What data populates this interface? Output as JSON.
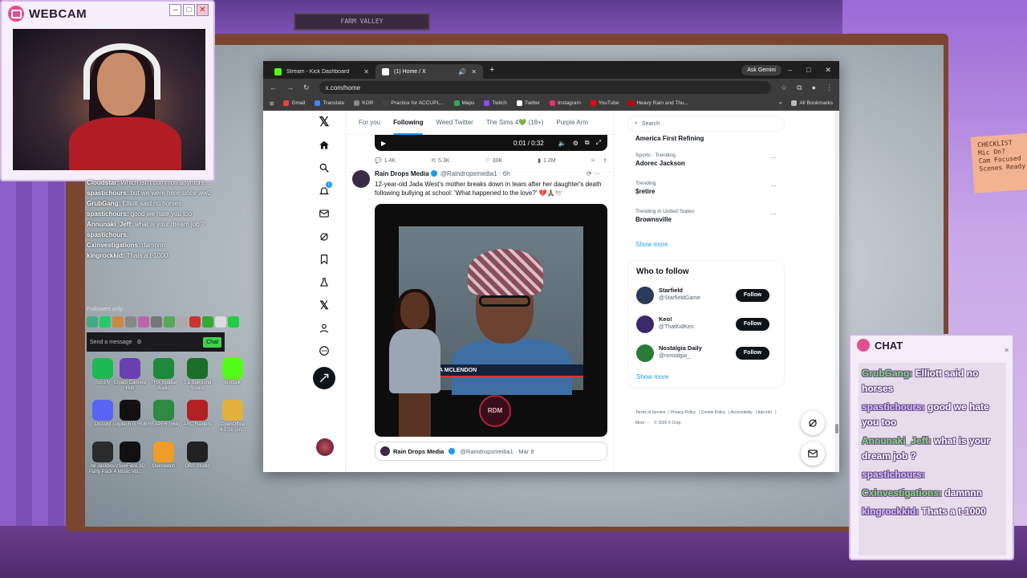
{
  "webcam": {
    "title": "WEBCAM",
    "controls": [
      "–",
      "□",
      "✕"
    ]
  },
  "scene": {
    "shelf_sign": "FARM VALLEY",
    "sticky_note": [
      "CHECKLIST",
      "Mic On?",
      "Cam Focused",
      "Scenes Ready"
    ]
  },
  "stream_chat": {
    "lines": [
      {
        "user": "Cloudstar:",
        "text": "Which isn't common anymore."
      },
      {
        "user": "spastichours:",
        "text": "but we were here since ww2"
      },
      {
        "user": "GrubGang:",
        "text": "Elliott said no horses"
      },
      {
        "user": "spastichours:",
        "text": "good we hate you too"
      },
      {
        "user": "Annunaki_Jeff:",
        "text": "what is your dream job ?"
      },
      {
        "user": "spastichours:",
        "text": ""
      },
      {
        "user": "Cxinvestigations:",
        "text": "damnnn"
      },
      {
        "user": "kingrockkid:",
        "text": "Thats a t-1000"
      }
    ],
    "followers_only": "Followers only",
    "send_placeholder": "Send a message",
    "chat_button": "Chat"
  },
  "desktop_icons": [
    {
      "label": "Spotify",
      "color": "#1db954"
    },
    {
      "label": "Elgato Camera Hub",
      "color": "#6a3fb0"
    },
    {
      "label": "THX Spatial Audio",
      "color": "#1c8a3a"
    },
    {
      "label": "7.1 Surround Sound",
      "color": "#1a6e2a"
    },
    {
      "label": "kicktalk",
      "color": "#53fc18"
    },
    {
      "label": "Discord",
      "color": "#5865f2"
    },
    {
      "label": "Logitech G HUB",
      "color": "#111111"
    },
    {
      "label": "REAPER (x64)",
      "color": "#2e8a3e"
    },
    {
      "label": "ARC Raiders",
      "color": "#b22222"
    },
    {
      "label": "OpenOffice 4.1.16 (en...",
      "color": "#e2b13c"
    },
    {
      "label": "he Jackbox Party Pack 4",
      "color": "#2b2b2b"
    },
    {
      "label": "VSeeFace 3D Music Vis...",
      "color": "#111111"
    },
    {
      "label": "Overwatch",
      "color": "#f09c28"
    },
    {
      "label": "OBS Studio",
      "color": "#222222"
    }
  ],
  "browser": {
    "tabs": [
      {
        "label": "Stream - Kick Dashboard",
        "color": "#53fc18"
      },
      {
        "label": "(1) Home / X",
        "color": "#ffffff"
      }
    ],
    "new_tab": "+",
    "ask_gemini": "Ask Gemini",
    "url": "x.com/home",
    "bookmarks": [
      {
        "label": "Gmail",
        "color": "#ea4335"
      },
      {
        "label": "Translate",
        "color": "#4285f4"
      },
      {
        "label": "KOR",
        "color": "#888888"
      },
      {
        "label": "Practice for ACCUPL...",
        "color": "#444444"
      },
      {
        "label": "Maps",
        "color": "#34a853"
      },
      {
        "label": "Twitch",
        "color": "#9146ff"
      },
      {
        "label": "Twitter",
        "color": "#ffffff"
      },
      {
        "label": "Instagram",
        "color": "#e1306c"
      },
      {
        "label": "YouTube",
        "color": "#ff0000"
      },
      {
        "label": "Heavy Rain and Thu...",
        "color": "#cc0000"
      }
    ],
    "all_bookmarks": "All Bookmarks"
  },
  "x": {
    "notification_count": "1",
    "feed_tabs": [
      "For you",
      "Following",
      "Weed Twitter",
      "The Sims 4💚 (18+)",
      "Purple Arm"
    ],
    "active_tab": "Following",
    "video_time": "0:01 / 0:32",
    "actions": {
      "replies": "1.4K",
      "reposts": "5.3K",
      "likes": "30K",
      "views": "1.2M"
    },
    "post": {
      "name": "Rain Drops Media",
      "handle": "@Raindropsmedia1 · 6h",
      "text": "12-year-old Jada West's mother breaks down in tears after her daughter's death following bullying at school: 'What happened to the love?' 💔🙏🏽🕊️",
      "lower_third": "A MCLENDON",
      "logo": "RDM"
    },
    "quote": {
      "name": "Rain Drops Media",
      "handle": "@Raindropsmedia1 · Mar 9"
    },
    "search_placeholder": "Search",
    "trends": [
      {
        "category": "",
        "name": "America First Refining"
      },
      {
        "category": "Sports · Trending",
        "name": "Adorec Jackson"
      },
      {
        "category": "Trending",
        "name": "$retire"
      },
      {
        "category": "Trending in United States",
        "name": "Brownsville"
      }
    ],
    "show_more": "Show more",
    "who_to_follow": "Who to follow",
    "follow_suggestions": [
      {
        "name": "Starfield",
        "handle": "@StarfieldGame",
        "color": "#2a3b5c"
      },
      {
        "name": "Keo!",
        "handle": "@ThatKidKeo",
        "color": "#3a2a6a"
      },
      {
        "name": "Nostalgia Daily",
        "handle": "@nostalgia_",
        "color": "#2a7a3a"
      }
    ],
    "follow_label": "Follow",
    "footer": [
      "Terms of Service",
      "Privacy Policy",
      "Cookie Policy",
      "Accessibility",
      "Ads info",
      "More ···",
      "© 2026 X Corp."
    ]
  },
  "right_chat": {
    "title": "CHAT",
    "lines": [
      {
        "user": "GrubGang:",
        "text": "Elliott said no horses"
      },
      {
        "user": "spastichours:",
        "text": "good we hate you too"
      },
      {
        "user": "Annunaki_Jeff:",
        "text": "what is your dream job ?"
      },
      {
        "user": "spastichours:",
        "text": ""
      },
      {
        "user": "Cxinvestigations:",
        "text": "damnnn"
      },
      {
        "user": "kingrockkid:",
        "text": "Thats a t-1000"
      }
    ]
  }
}
